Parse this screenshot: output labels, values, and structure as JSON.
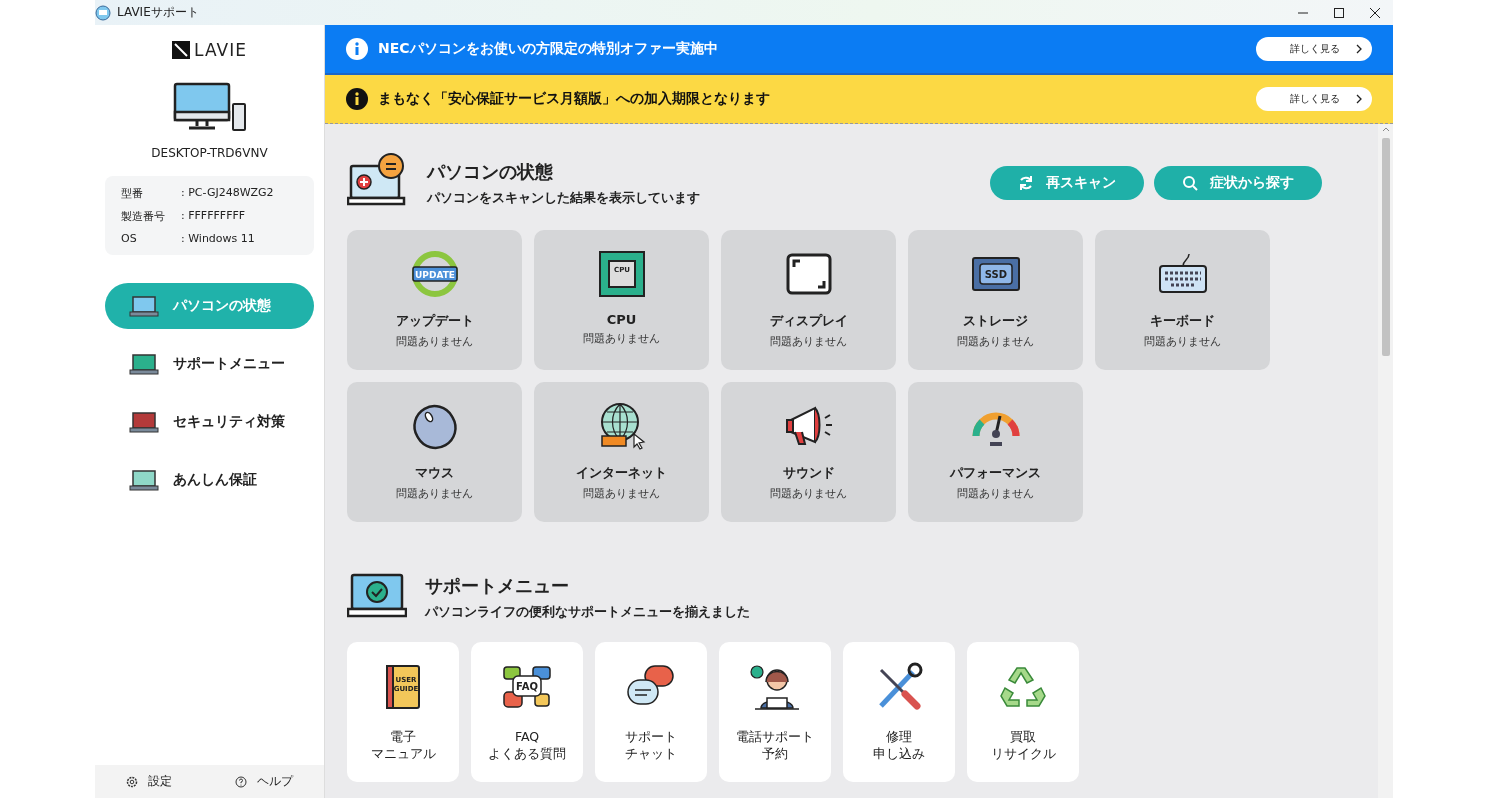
{
  "window": {
    "title": "LAVIEサポート"
  },
  "sidebar": {
    "logo": "LAVIE",
    "device_name": "DESKTOP-TRD6VNV",
    "specs": [
      {
        "label": "型番",
        "value": ": PC-GJ248WZG2"
      },
      {
        "label": "製造番号",
        "value": ": FFFFFFFFF"
      },
      {
        "label": "OS",
        "value": ": Windows 11"
      }
    ],
    "nav": [
      {
        "label": "パソコンの状態",
        "selected": true
      },
      {
        "label": "サポートメニュー",
        "selected": false
      },
      {
        "label": "セキュリティ対策",
        "selected": false
      },
      {
        "label": "あんしん保証",
        "selected": false
      }
    ],
    "footer": [
      {
        "kind": "settings",
        "label": "設定"
      },
      {
        "kind": "help",
        "label": "ヘルプ"
      }
    ]
  },
  "banners": [
    {
      "kind": "info",
      "text": "NECパソコンをお使いの方限定の特別オファー実施中",
      "button": "詳しく見る"
    },
    {
      "kind": "warning",
      "text": "まもなく「安心保証サービス月額版」への加入期限となります",
      "button": "詳しく見る"
    }
  ],
  "status_section": {
    "title": "パソコンの状態",
    "subtitle": "パソコンをスキャンした結果を表示しています",
    "actions": [
      {
        "kind": "rescan",
        "label": "再スキャン"
      },
      {
        "kind": "search",
        "label": "症状から探す"
      }
    ],
    "items": [
      {
        "name": "アップデート",
        "status": "問題ありません",
        "icon_text": [
          "UPDATE"
        ]
      },
      {
        "name": "CPU",
        "status": "問題ありません",
        "icon_text": [
          "CPU"
        ]
      },
      {
        "name": "ディスプレイ",
        "status": "問題ありません"
      },
      {
        "name": "ストレージ",
        "status": "問題ありません",
        "icon_text": [
          "SSD"
        ]
      },
      {
        "name": "キーボード",
        "status": "問題ありません"
      },
      {
        "name": "マウス",
        "status": "問題ありません"
      },
      {
        "name": "インターネット",
        "status": "問題ありません"
      },
      {
        "name": "サウンド",
        "status": "問題ありません"
      },
      {
        "name": "パフォーマンス",
        "status": "問題ありません"
      }
    ]
  },
  "support_section": {
    "title": "サポートメニュー",
    "subtitle": "パソコンライフの便利なサポートメニューを揃えました",
    "items": [
      {
        "lines": [
          "電子",
          "マニュアル"
        ],
        "icon_text": [
          "USER",
          "GUIDE"
        ]
      },
      {
        "lines": [
          "FAQ",
          "よくある質問"
        ],
        "icon_text": [
          "FAQ"
        ]
      },
      {
        "lines": [
          "サポート",
          "チャット"
        ]
      },
      {
        "lines": [
          "電話サポート",
          "予約"
        ]
      },
      {
        "lines": [
          "修理",
          "申し込み"
        ]
      },
      {
        "lines": [
          "買取",
          "リサイクル"
        ]
      }
    ]
  }
}
